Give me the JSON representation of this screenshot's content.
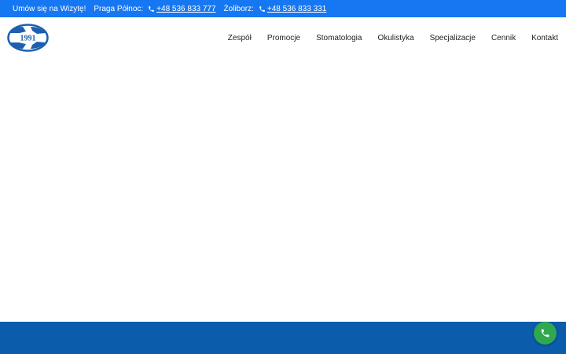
{
  "topbar": {
    "cta": "Umów się na Wizytę!",
    "locations": [
      {
        "name": "Praga Północ:",
        "phone": "+48 536 833 777"
      },
      {
        "name": "Żoliborz:",
        "phone": "+48 536 833 331"
      }
    ]
  },
  "logo": {
    "year": "1991"
  },
  "nav": {
    "items": [
      "Zespół",
      "Promocje",
      "Stomatologia",
      "Okulistyka",
      "Specjalizacje",
      "Cennik",
      "Kontakt"
    ]
  },
  "colors": {
    "topbar": "#1677f2",
    "footer": "#0b5cab",
    "call_button": "#2fa84f",
    "logo": "#1d5fae"
  },
  "icons": {
    "phone": "phone-icon",
    "call_fab": "phone-icon"
  }
}
